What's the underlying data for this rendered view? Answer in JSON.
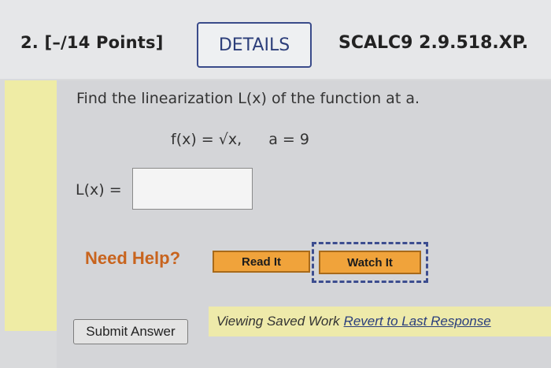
{
  "question": {
    "number": "2.",
    "points": "[–/14 Points]",
    "details_label": "DETAILS",
    "code": "SCALC9 2.9.518.XP."
  },
  "problem": {
    "prompt": "Find the linearization L(x) of the function at a.",
    "function": "f(x) = √x,",
    "a_value": "a = 9",
    "answer_label": "L(x) =",
    "answer_value": ""
  },
  "help": {
    "label": "Need Help?",
    "read_label": "Read It",
    "watch_label": "Watch It"
  },
  "footer": {
    "saved_text": "Viewing Saved Work",
    "revert_label": "Revert to Last Response",
    "submit_label": "Submit Answer"
  },
  "colors": {
    "accent_orange": "#f0a33b",
    "help_text": "#c8641e",
    "link_blue": "#2a3e7c",
    "highlight_yellow": "#efeca5"
  }
}
